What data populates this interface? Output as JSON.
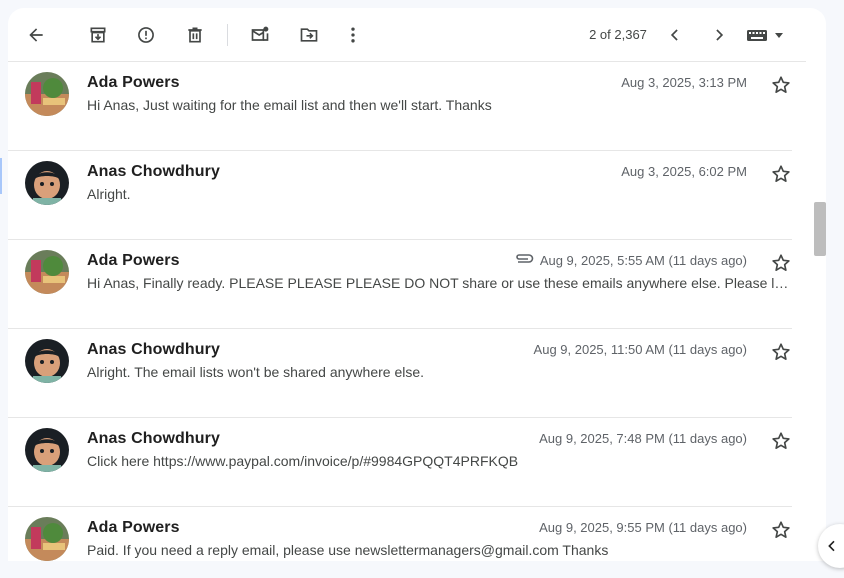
{
  "toolbar": {
    "pager_text": "2 of 2,367",
    "icons": [
      "back-arrow-icon",
      "archive-icon",
      "report-spam-icon",
      "delete-icon",
      "mark-unread-icon",
      "move-to-icon",
      "more-vert-icon",
      "chevron-left-icon",
      "chevron-right-icon",
      "keyboard-icon"
    ]
  },
  "messages": [
    {
      "sender": "Ada Powers",
      "date": "Aug 3, 2025, 3:13 PM",
      "snippet": "Hi Anas, Just waiting for the email list and then we'll start. Thanks",
      "avatar": "ada",
      "attachment": false
    },
    {
      "sender": "Anas Chowdhury",
      "date": "Aug 3, 2025, 6:02 PM",
      "snippet": "Alright.",
      "avatar": "anas",
      "attachment": false
    },
    {
      "sender": "Ada Powers",
      "date": "Aug 9, 2025, 5:55 AM (11 days ago)",
      "snippet": "Hi Anas, Finally ready. PLEASE PLEASE PLEASE DO NOT share or use these emails anywhere else. Please let us know once you are done and we will share the next list with you.",
      "avatar": "ada",
      "attachment": true
    },
    {
      "sender": "Anas Chowdhury",
      "date": "Aug 9, 2025, 11:50 AM (11 days ago)",
      "snippet": "Alright. The email lists won't be shared anywhere else.",
      "avatar": "anas",
      "attachment": false
    },
    {
      "sender": "Anas Chowdhury",
      "date": "Aug 9, 2025, 7:48 PM (11 days ago)",
      "snippet": "Click here https://www.paypal.com/invoice/p/#9984GPQQT4PRFKQB",
      "avatar": "anas",
      "attachment": false
    },
    {
      "sender": "Ada Powers",
      "date": "Aug 9, 2025, 9:55 PM (11 days ago)",
      "snippet": "Paid. If you need a reply email, please use newslettermanagers@gmail.com Thanks",
      "avatar": "ada",
      "attachment": false
    }
  ],
  "colors": {
    "icon": "#444746",
    "page_bg": "#f6f8fc",
    "divider": "#e6e6e6"
  }
}
